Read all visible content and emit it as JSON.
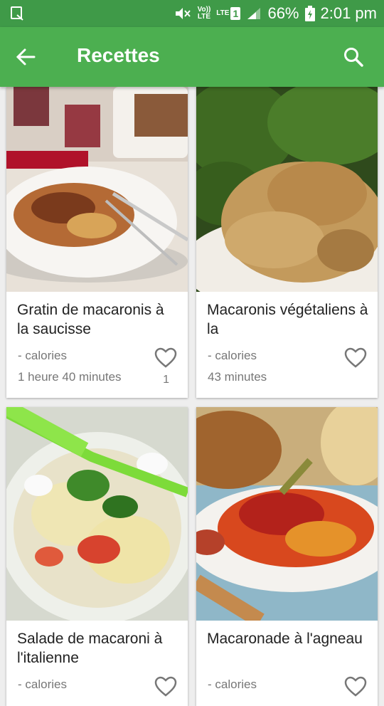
{
  "status_bar": {
    "volte_top": "Vo))",
    "volte_bottom": "LTE",
    "lte_label": "LTE",
    "sim_slot": "1",
    "battery": "66%",
    "time": "2:01 pm"
  },
  "app_bar": {
    "title": "Recettes",
    "back_icon": "arrow-back-icon",
    "search_icon": "search-icon"
  },
  "recipes": [
    {
      "name": "Gratin de macaronis à la saucisse",
      "calories": "- calories",
      "time": "1 heure 40 minutes",
      "likes": "1"
    },
    {
      "name": "Macaronis végétaliens à la",
      "calories": "- calories",
      "time": "43 minutes",
      "likes": ""
    },
    {
      "name": "Salade de macaroni à l'italienne",
      "calories": "- calories",
      "time": "",
      "likes": ""
    },
    {
      "name": "Macaronade à l'agneau",
      "calories": "- calories",
      "time": "",
      "likes": ""
    }
  ],
  "colors": {
    "status_bar": "#3f9a48",
    "app_bar": "#4caf50",
    "background": "#eeeeee"
  }
}
